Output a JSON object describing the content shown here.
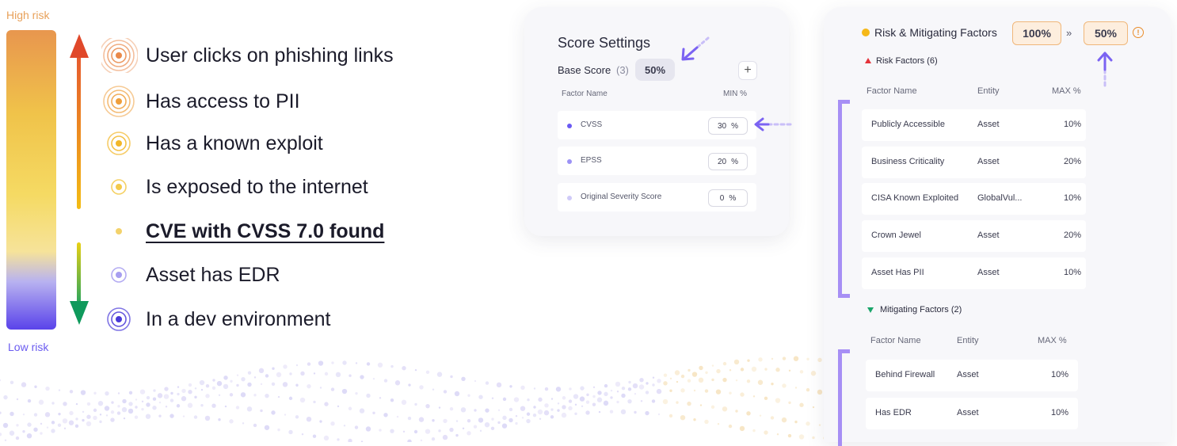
{
  "scale": {
    "top_label": "High risk",
    "bottom_label": "Low risk",
    "factors": [
      {
        "text": "User clicks on phishing links",
        "icon": "concentric-rings-orange-icon",
        "color": "#e9894a",
        "rings": 4
      },
      {
        "text": "Has access to PII",
        "icon": "concentric-rings-orange-icon",
        "color": "#ef9f3c",
        "rings": 3
      },
      {
        "text": "Has a known exploit",
        "icon": "concentric-rings-yellow-icon",
        "color": "#f2b728",
        "rings": 2
      },
      {
        "text": "Is exposed to the internet",
        "icon": "concentric-rings-yellow-icon",
        "color": "#f3c94a",
        "rings": 1
      },
      {
        "text": "CVE with CVSS 7.0 found",
        "icon": "dot-yellow-icon",
        "color": "#f3d26b",
        "rings": 0
      },
      {
        "text": "Asset has EDR",
        "icon": "concentric-rings-lavender-icon",
        "color": "#a79ef0",
        "rings": 1
      },
      {
        "text": "In a dev environment",
        "icon": "concentric-rings-purple-icon",
        "color": "#4a3ad8",
        "rings": 2
      }
    ],
    "active_index": 4
  },
  "score_settings": {
    "title": "Score Settings",
    "base_score_label": "Base Score",
    "base_score_count": "(3)",
    "base_score_value": "50%",
    "add_label": "+",
    "col_factor": "Factor Name",
    "col_min": "MIN %",
    "rows": [
      {
        "name": "CVSS",
        "value": "30",
        "unit": "%",
        "dot": "#6a5af3"
      },
      {
        "name": "EPSS",
        "value": "20",
        "unit": "%",
        "dot": "#9c92f5"
      },
      {
        "name": "Original Severity Score",
        "value": "0",
        "unit": "%",
        "dot": "#cfcaf8"
      }
    ]
  },
  "risk_panel": {
    "title": "Risk & Mitigating Factors",
    "from_value": "100%",
    "separator": "»",
    "to_value": "50%",
    "warn": "!",
    "risk_section": "Risk Factors (6)",
    "mitigating_section": "Mitigating Factors (2)",
    "col_factor": "Factor Name",
    "col_entity": "Entity",
    "col_max": "MAX %",
    "risk_rows": [
      {
        "name": "Publicly Accessible",
        "entity": "Asset",
        "max": "10%"
      },
      {
        "name": "Business Criticality",
        "entity": "Asset",
        "max": "20%"
      },
      {
        "name": "CISA Known Exploited",
        "entity": "GlobalVul...",
        "max": "10%"
      },
      {
        "name": "Crown Jewel",
        "entity": "Asset",
        "max": "20%"
      },
      {
        "name": "Asset Has PII",
        "entity": "Asset",
        "max": "10%"
      }
    ],
    "mitigating_rows": [
      {
        "name": "Behind Firewall",
        "entity": "Asset",
        "max": "10%"
      },
      {
        "name": "Has EDR",
        "entity": "Asset",
        "max": "10%"
      }
    ]
  },
  "colors": {
    "accent": "#7b63f2",
    "bracket": "#a78ff5",
    "warning": "#e98c2a"
  }
}
